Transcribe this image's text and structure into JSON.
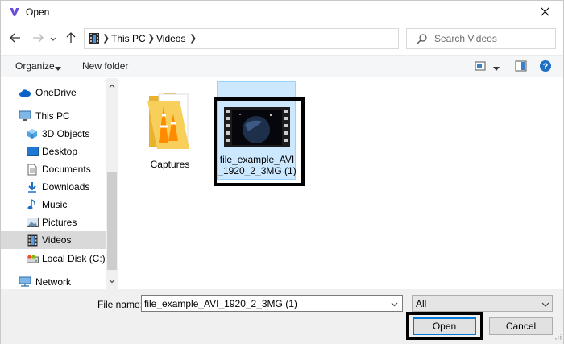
{
  "window": {
    "title": "Open",
    "close_icon": "close-icon",
    "app_icon": "app-logo-icon"
  },
  "navigation": {
    "back_icon": "back-arrow-icon",
    "forward_icon": "forward-arrow-icon",
    "recent_icon": "recent-locations-chevron-icon",
    "up_icon": "up-arrow-icon"
  },
  "address_bar": {
    "breadcrumbs": [
      "This PC",
      "Videos"
    ],
    "location_icon": "videos-folder-icon",
    "refresh_icon": "refresh-icon"
  },
  "search": {
    "placeholder": "Search Videos"
  },
  "toolbar": {
    "organize_label": "Organize",
    "new_folder_label": "New folder",
    "view_icon": "change-view-icon",
    "preview_icon": "preview-pane-icon",
    "help_icon": "help-icon"
  },
  "sidebar": {
    "items": [
      {
        "label": "OneDrive",
        "icon": "cloud-icon"
      },
      {
        "label": "This PC",
        "icon": "computer-icon"
      },
      {
        "label": "3D Objects",
        "icon": "cube-icon"
      },
      {
        "label": "Desktop",
        "icon": "desktop-icon"
      },
      {
        "label": "Documents",
        "icon": "document-icon"
      },
      {
        "label": "Downloads",
        "icon": "download-arrow-icon"
      },
      {
        "label": "Music",
        "icon": "music-note-icon"
      },
      {
        "label": "Pictures",
        "icon": "picture-icon"
      },
      {
        "label": "Videos",
        "icon": "film-icon",
        "selected": true
      },
      {
        "label": "Local Disk (C:)",
        "icon": "drive-icon"
      },
      {
        "label": "Network",
        "icon": "network-icon"
      }
    ]
  },
  "files": [
    {
      "name": "Captures",
      "type": "folder",
      "icon": "folder-icon"
    },
    {
      "name_line1": "file_example_AVI",
      "name_line2": "_1920_2_3MG (1)",
      "type": "video",
      "icon": "video-thumbnail-icon",
      "selected": true
    }
  ],
  "bottom": {
    "file_name_label": "File name:",
    "file_name_value": "file_example_AVI_1920_2_3MG (1)",
    "file_type_value": "All",
    "open_label": "Open",
    "cancel_label": "Cancel"
  },
  "colors": {
    "selection": "#cce8ff",
    "selection_border": "#99d1ff",
    "accent": "#0078d7",
    "highlight": "#000000"
  }
}
